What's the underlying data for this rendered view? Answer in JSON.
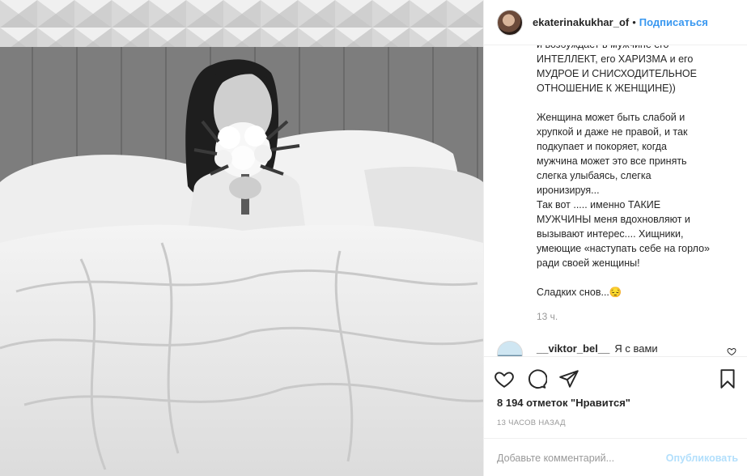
{
  "header": {
    "username": "ekaterinakukhar_of",
    "separator": "•",
    "follow_label": "Подписаться"
  },
  "caption": {
    "paragraphs": [
      "и возбуждает в мужчине его\nИНТЕЛЛЕКТ, его ХАРИЗМА и его\nМУДРОЕ И СНИСХОДИТЕЛЬНОЕ\nОТНОШЕНИЕ К ЖЕНЩИНЕ))",
      "Женщина может быть слабой и\nхрупкой и даже не правой, и так\nподкупает и покоряет, когда\nмужчина может это все принять\nслегка улыбаясь, слегка\nиронизируя...\nТак вот ..... именно ТАКИЕ\nМУЖЧИНЫ меня вдохновляют и\nвызывают интерес.... Хищники,\nумеющие «наступать себе на горло»\nради своей женщины!",
      "Сладких снов...😔"
    ],
    "time_ago": "13 ч."
  },
  "comment": {
    "user": "__viktor_bel__",
    "text": "Я с вами"
  },
  "actions": {
    "likes_text": "8 194 отметок \"Нравится\"",
    "posted_ago": "13 ЧАСОВ НАЗАД"
  },
  "add_comment": {
    "placeholder": "Добавьте комментарий...",
    "publish_label": "Опубликовать"
  },
  "colors": {
    "link_blue": "#3897f0",
    "publish_disabled": "#b2dffc",
    "muted_text": "#999999",
    "divider": "#efefef"
  },
  "icons": {
    "like": "heart-icon",
    "comment": "comment-bubble-icon",
    "share": "paper-plane-icon",
    "save": "bookmark-icon"
  }
}
